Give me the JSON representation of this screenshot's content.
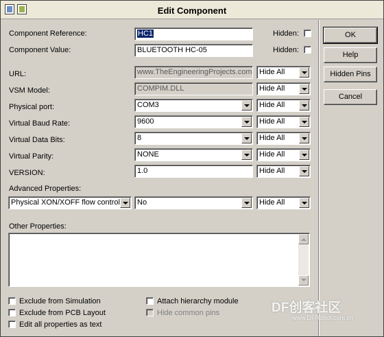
{
  "window": {
    "title": "Edit Component"
  },
  "component_reference": {
    "label": "Component Reference:",
    "value": "HC1",
    "hidden_label": "Hidden:"
  },
  "component_value": {
    "label": "Component Value:",
    "value": "BLUETOOTH HC-05",
    "hidden_label": "Hidden:"
  },
  "properties": [
    {
      "label": "URL:",
      "value": "www.TheEngineeringProjects.com",
      "visibility": "Hide All"
    },
    {
      "label": "VSM Model:",
      "value": "COMPIM.DLL",
      "visibility": "Hide All"
    },
    {
      "label": "Physical port:",
      "value": "COM3",
      "visibility": "Hide All"
    },
    {
      "label": "Virtual Baud Rate:",
      "value": "9600",
      "visibility": "Hide All"
    },
    {
      "label": "Virtual Data Bits:",
      "value": "8",
      "visibility": "Hide All"
    },
    {
      "label": "Virtual Parity:",
      "value": "NONE",
      "visibility": "Hide All"
    },
    {
      "label": "VERSION:",
      "value": "1.0",
      "visibility": "Hide All"
    }
  ],
  "advanced": {
    "label": "Advanced Properties:",
    "property": "Physical XON/XOFF flow control",
    "value": "No",
    "visibility": "Hide All"
  },
  "other_properties": {
    "label": "Other Properties:",
    "text": ""
  },
  "buttons": {
    "ok": "OK",
    "help": "Help",
    "hidden_pins": "Hidden Pins",
    "cancel": "Cancel"
  },
  "checkboxes": {
    "exclude_simulation": "Exclude from Simulation",
    "exclude_pcb": "Exclude from PCB Layout",
    "edit_all_text": "Edit all properties as text",
    "attach_hierarchy": "Attach hierarchy module",
    "hide_common_pins": "Hide common pins"
  },
  "watermark": {
    "brand": "DF创客社区",
    "url": "www.DFRobot.com.cn"
  }
}
